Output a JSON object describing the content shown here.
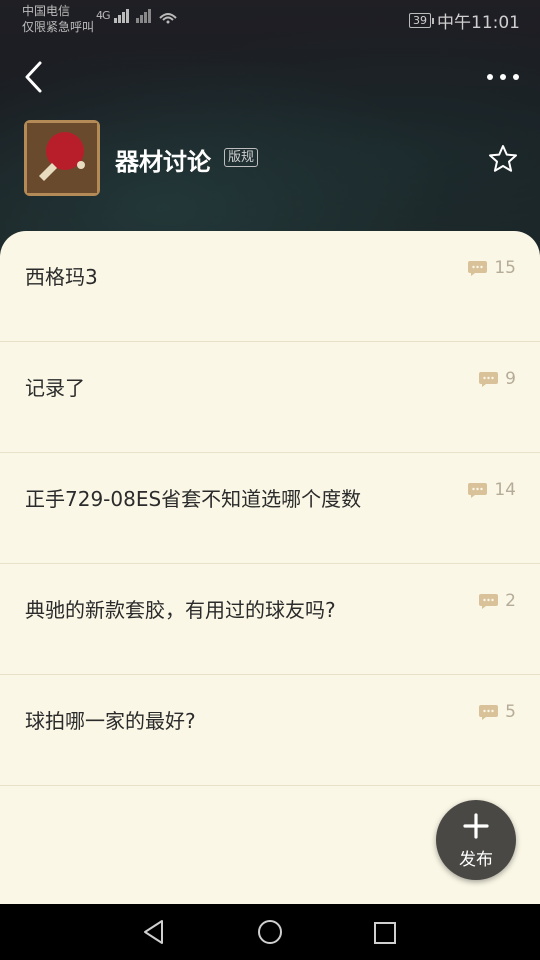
{
  "status_bar": {
    "carrier_line1": "中国电信",
    "carrier_line2": "仅限紧急呼叫",
    "signal_text": "4G",
    "battery": "39",
    "time": "中午11:01"
  },
  "header": {
    "back_icon": "chevron-left-icon",
    "more_icon": "more-dots-icon"
  },
  "forum": {
    "name": "器材讨论",
    "tag": "版规",
    "icon": "ping-pong-paddle-icon",
    "star_icon": "star-outline-icon"
  },
  "posts": [
    {
      "title": "西格玛3",
      "comments": "15"
    },
    {
      "title": "记录了",
      "comments": "9"
    },
    {
      "title": "正手729-08ES省套不知道选哪个度数",
      "comments": "14"
    },
    {
      "title": "典驰的新款套胶，有用过的球友吗?",
      "comments": "2"
    },
    {
      "title": "球拍哪一家的最好?",
      "comments": "5"
    }
  ],
  "fab": {
    "label": "发布",
    "icon": "plus-icon"
  },
  "colors": {
    "content_bg": "#faf7e6",
    "accent_bubble": "#d9c29a",
    "fab_bg": "#4a4844",
    "paddle_red": "#b81e2a"
  }
}
